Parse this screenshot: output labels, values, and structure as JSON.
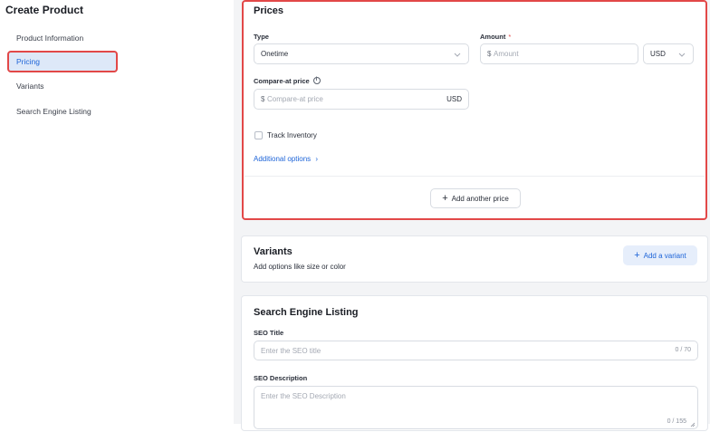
{
  "sidebar": {
    "title": "Create Product",
    "items": [
      {
        "label": "Product Information"
      },
      {
        "label": "Pricing"
      },
      {
        "label": "Variants"
      },
      {
        "label": "Search Engine Listing"
      }
    ]
  },
  "prices": {
    "title": "Prices",
    "type_label": "Type",
    "type_value": "Onetime",
    "amount_label": "Amount",
    "amount_required": "*",
    "amount_currency_symbol": "$",
    "amount_placeholder": "Amount",
    "currency_value": "USD",
    "compare_label": "Compare-at price",
    "compare_currency_symbol": "$",
    "compare_placeholder": "Compare-at price",
    "compare_currency": "USD",
    "track_inventory_label": "Track Inventory",
    "additional_options_label": "Additional options",
    "add_price_label": "Add another price"
  },
  "variants": {
    "title": "Variants",
    "subtitle": "Add options like size or color",
    "add_label": "Add a variant"
  },
  "seo": {
    "title": "Search Engine Listing",
    "seo_title_label": "SEO Title",
    "seo_title_placeholder": "Enter the SEO title",
    "seo_title_counter": "0 / 70",
    "seo_desc_label": "SEO Description",
    "seo_desc_placeholder": "Enter the SEO Description",
    "seo_desc_counter": "0 / 155"
  },
  "colors": {
    "accent": "#1d64d8",
    "highlight": "#e24848",
    "active_bg": "#dde8f8"
  }
}
